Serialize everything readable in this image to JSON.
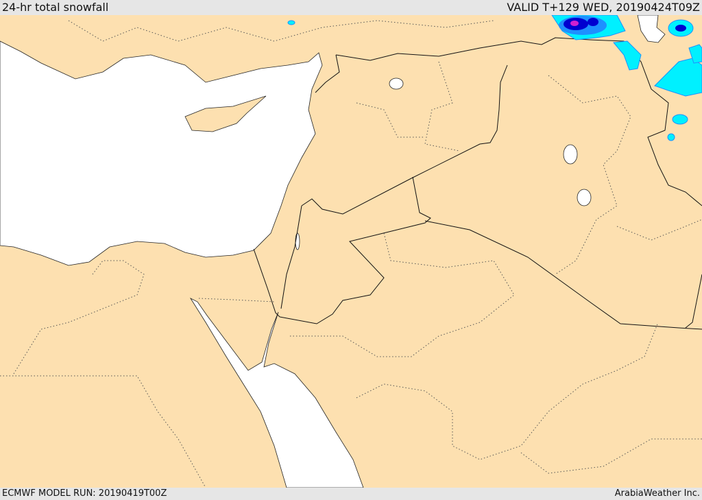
{
  "header": {
    "title": "24-hr total snowfall",
    "valid": "VALID T+129 WED, 20190424T09Z"
  },
  "footer": {
    "model_run": "ECMWF MODEL RUN: 20190419T00Z",
    "credit": "ArabiaWeather Inc."
  },
  "colors": {
    "land": "#fde0b0",
    "sea": "#ffffff",
    "snow_light": "#00f0ff",
    "snow_mid": "#1e90ff",
    "snow_heavy": "#0000d0",
    "snow_max": "#d020d0"
  }
}
